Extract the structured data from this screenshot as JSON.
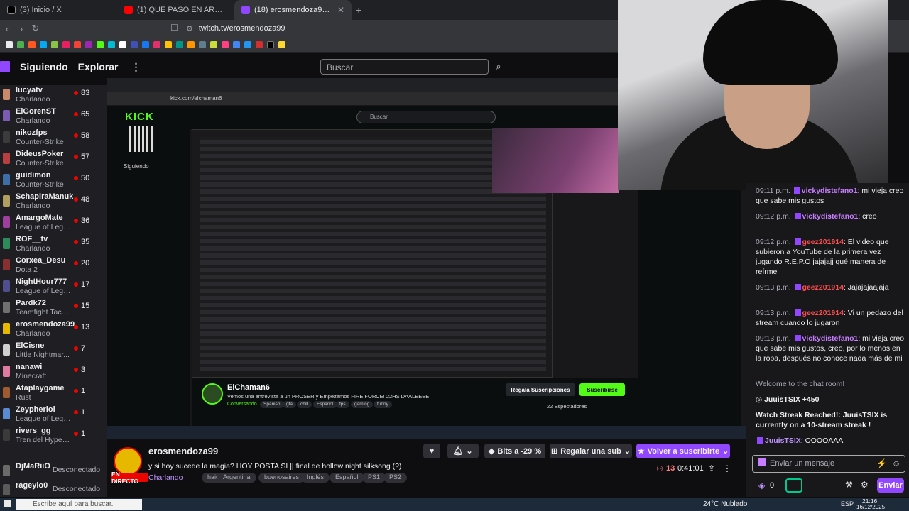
{
  "browser": {
    "tabs": [
      {
        "title": "(3) Inicio / X",
        "color": "#000000"
      },
      {
        "title": "(1) QUÉ PASÓ EN ARGENTINA? | NO",
        "color": "#ff0000"
      },
      {
        "title": "(18) erosmendoza99 - Twitch",
        "color": "#9147ff"
      }
    ],
    "url": "twitch.tv/erosmendoza99"
  },
  "twitch_nav": {
    "following": "Siguiendo",
    "explore": "Explorar",
    "search_placeholder": "Buscar"
  },
  "sidebar": {
    "channels": [
      {
        "name": "lucyatv",
        "game": "Charlando",
        "viewers": "83",
        "color": "#c98a6c"
      },
      {
        "name": "ElGorenST",
        "game": "Charlando",
        "viewers": "65",
        "color": "#7c5cb3"
      },
      {
        "name": "nikozfps",
        "game": "Counter-Strike",
        "viewers": "58",
        "color": "#3b3b3b"
      },
      {
        "name": "DideusPoker",
        "game": "Counter-Strike",
        "viewers": "57",
        "color": "#b83f3f"
      },
      {
        "name": "guidimon",
        "game": "Counter-Strike",
        "viewers": "50",
        "color": "#3d6ea8"
      },
      {
        "name": "SchapiraManuk",
        "game": "Charlando",
        "viewers": "48",
        "color": "#b0a060"
      },
      {
        "name": "AmargoMate",
        "game": "League of Lege...",
        "viewers": "36",
        "color": "#9e3f9e"
      },
      {
        "name": "ROF__tv",
        "game": "Charlando",
        "viewers": "35",
        "color": "#2f8a5a"
      },
      {
        "name": "Corxea_Desu",
        "game": "Dota 2",
        "viewers": "20",
        "color": "#8a2f2f"
      },
      {
        "name": "NightHour777",
        "game": "League of Lege...",
        "viewers": "17",
        "color": "#4f4f90"
      },
      {
        "name": "Pardk72",
        "game": "Teamfight Tacti...",
        "viewers": "15",
        "color": "#707070"
      },
      {
        "name": "erosmendoza99",
        "game": "Charlando",
        "viewers": "13",
        "color": "#e6b800"
      },
      {
        "name": "ElCisne",
        "game": "Little Nightmar...",
        "viewers": "7",
        "color": "#cfcfcf"
      },
      {
        "name": "nanawi_",
        "game": "Minecraft",
        "viewers": "3",
        "color": "#e07aa0"
      },
      {
        "name": "Ataplaygame",
        "game": "Rust",
        "viewers": "1",
        "color": "#a05a2f"
      },
      {
        "name": "Zeypherlol",
        "game": "League of Lege...",
        "viewers": "1",
        "color": "#5a8ad0"
      },
      {
        "name": "rivers_gg",
        "game": "Tren del Hype • Niv...",
        "viewers": "1",
        "color": "#3a3a3a"
      }
    ],
    "offline": [
      {
        "name": "DjMaRiiO",
        "status": "Desconectado",
        "color": "#6a6a6a"
      },
      {
        "name": "rageylo0",
        "status": "Desconectado",
        "color": "#5a5a5a"
      }
    ]
  },
  "inner": {
    "url": "kick.com/elchaman6",
    "logo": "KICK",
    "search": "Buscar",
    "following": "Siguiendo",
    "streamer": "ElChaman6",
    "title": "Vemos una entrevista a un PROSER y Empezamos FIRE FORCE! 22HS DAALEEEE",
    "category": "Conversando",
    "tags": [
      "Spanish",
      "gta",
      "chill",
      "Español",
      "fps",
      "gaming",
      "funny"
    ],
    "gift_btn": "Regala Suscripciones",
    "sub_btn": "Suscribirse",
    "viewers": "22 Espectadores"
  },
  "stream": {
    "name": "erosmendoza99",
    "title": "y si hoy sucede la magia? HOY POSTA SI || final de hollow night silksong (?)",
    "category": "Charlando",
    "tags": [
      "haicrew",
      "Argentina",
      "buenosaires",
      "Inglés",
      "Español",
      "PS1",
      "PS2"
    ],
    "live": "EN DIRECTO",
    "bits": "Bits a -29 %",
    "gift": "Regalar una sub",
    "subscribe": "Volver a suscribirte",
    "viewers": "13",
    "uptime": "0:41:01"
  },
  "chat": {
    "messages": [
      {
        "time": "09:11 p.m.",
        "user": "vickydistefano1",
        "text": ": mi vieja creo que sabe mis gustos",
        "color": "#c77dff"
      },
      {
        "time": "09:12 p.m.",
        "user": "vickydistefano1",
        "text": ": creo",
        "color": "#c77dff"
      },
      {
        "time": "09:12 p.m.",
        "user": "geez201914",
        "text": ": El video que subieron a YouTube de la primera vez jugando R.E.P.O jajajajj qué manera de reírme",
        "color": "#ff4d4d"
      },
      {
        "time": "09:13 p.m.",
        "user": "geez201914",
        "text": ": Jajajajaajaja",
        "color": "#ff4d4d"
      },
      {
        "time": "09:13 p.m.",
        "user": "geez201914",
        "text": ": Vi un pedazo del stream cuando lo jugaron",
        "color": "#ff4d4d"
      },
      {
        "time": "09:13 p.m.",
        "user": "vickydistefano1",
        "text": ": mi vieja creo que sabe mis gustos, creo, por lo menos en la ropa, después no conoce nada más de mi",
        "color": "#c77dff"
      }
    ],
    "welcome": "Welcome to the chat room!",
    "juuis_points": "JuuisTSIX +450",
    "watch_streak": "Watch Streak Reached!: JuuisTSIX is currently on a 10-stream streak !",
    "juuis_msg_user": "JuuisTSIX",
    "juuis_msg": ": OOOOAAA",
    "last_user": "vickydistefano1",
    "last_msg": ": mi vieja creo que sabe mis gustos, creo, por lo menos en la ropa, después no conoce nada más de mi",
    "input_placeholder": "Enviar un mensaje",
    "points": "0",
    "send": "Enviar"
  },
  "taskbar": {
    "search": "Escribe aquí para buscar.",
    "weather": "24°C Nublado",
    "lang": "ESP",
    "time": "21:16",
    "date": "16/12/2025"
  }
}
